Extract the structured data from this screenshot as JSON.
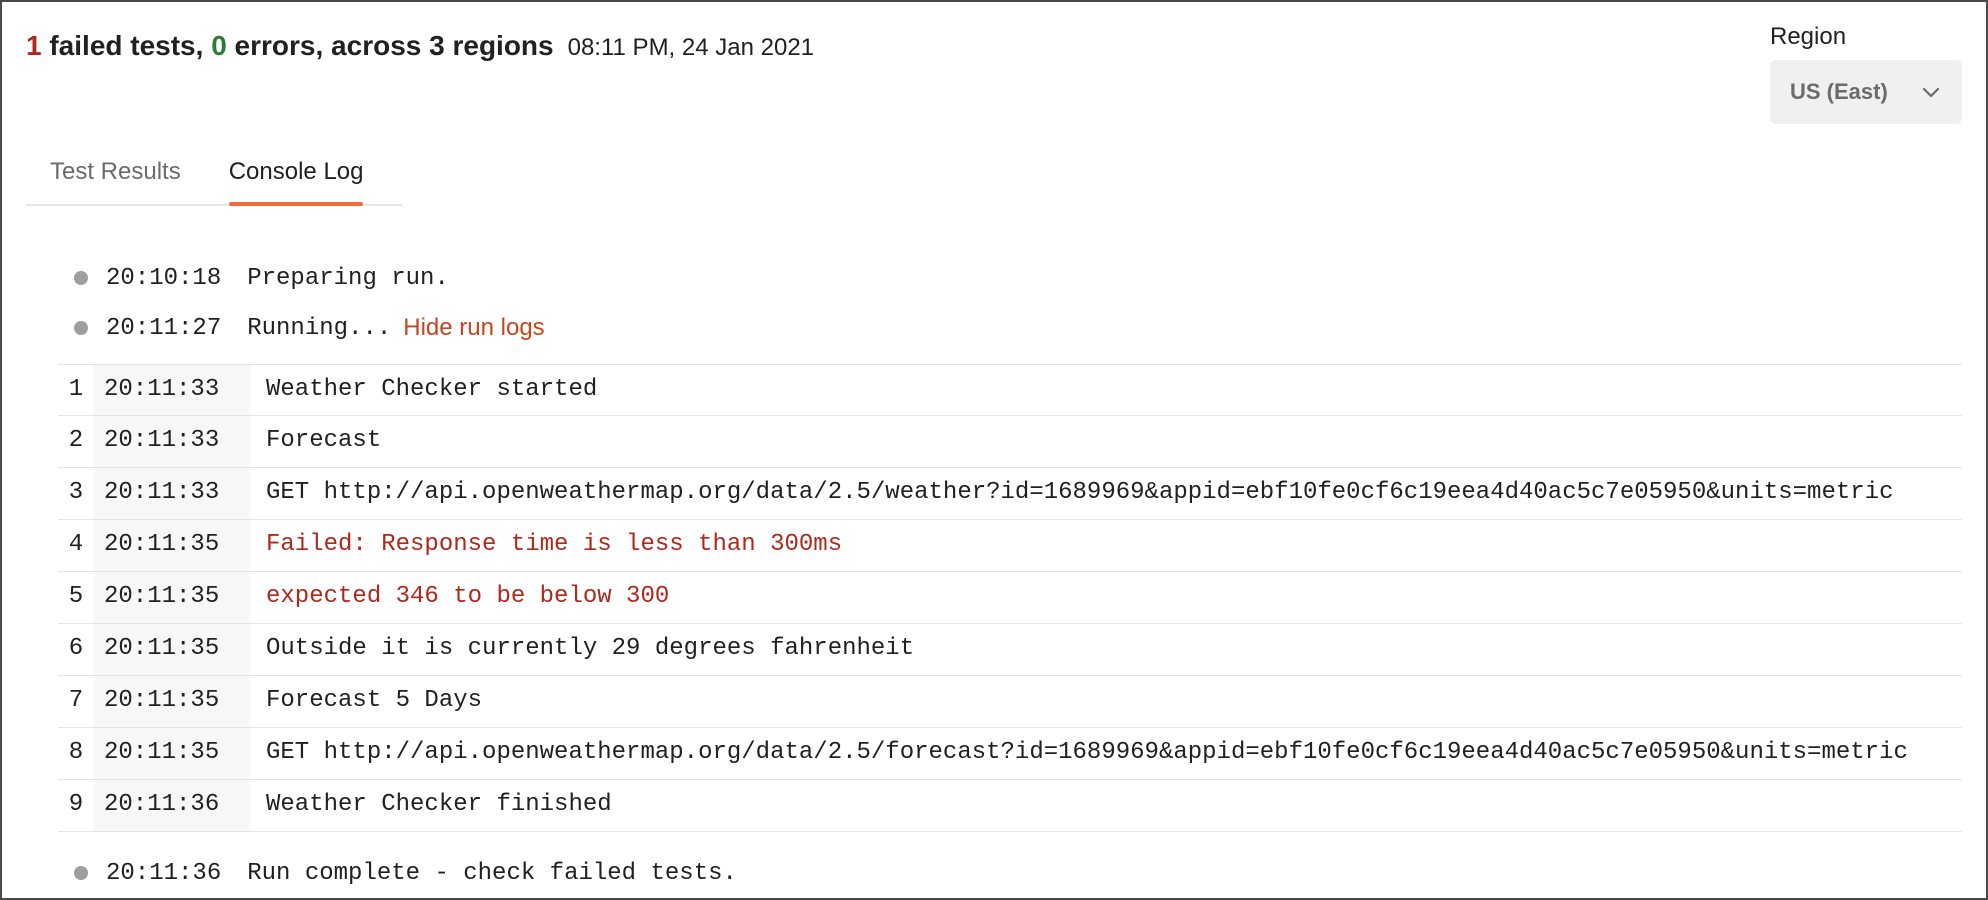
{
  "header": {
    "failed_count": "1",
    "failed_text": " failed tests, ",
    "error_count": "0",
    "error_text": " errors, across 3 regions",
    "timestamp": "08:11 PM, 24 Jan 2021"
  },
  "region": {
    "label": "Region",
    "selected": "US (East)"
  },
  "tabs": [
    {
      "label": "Test Results",
      "active": false
    },
    {
      "label": "Console Log",
      "active": true
    }
  ],
  "console": {
    "pre_status": [
      {
        "time": "20:10:18",
        "text": "Preparing run."
      },
      {
        "time": "20:11:27",
        "text": "Running...",
        "link": "Hide run logs"
      }
    ],
    "logs": [
      {
        "index": "1",
        "time": "20:11:33",
        "message": "Weather Checker started",
        "error": false
      },
      {
        "index": "2",
        "time": "20:11:33",
        "message": "Forecast",
        "error": false
      },
      {
        "index": "3",
        "time": "20:11:33",
        "message": "GET http://api.openweathermap.org/data/2.5/weather?id=1689969&appid=ebf10fe0cf6c19eea4d40ac5c7e05950&units=metric",
        "error": false
      },
      {
        "index": "4",
        "time": "20:11:35",
        "message": "Failed: Response time is less than 300ms",
        "error": true
      },
      {
        "index": "5",
        "time": "20:11:35",
        "message": "expected 346 to be below 300",
        "error": true
      },
      {
        "index": "6",
        "time": "20:11:35",
        "message": "Outside it is currently 29 degrees fahrenheit",
        "error": false
      },
      {
        "index": "7",
        "time": "20:11:35",
        "message": "Forecast 5 Days",
        "error": false
      },
      {
        "index": "8",
        "time": "20:11:35",
        "message": "GET http://api.openweathermap.org/data/2.5/forecast?id=1689969&appid=ebf10fe0cf6c19eea4d40ac5c7e05950&units=metric",
        "error": false
      },
      {
        "index": "9",
        "time": "20:11:36",
        "message": "Weather Checker finished",
        "error": false
      }
    ],
    "post_status": {
      "time": "20:11:36",
      "text": "Run complete - check failed tests."
    }
  },
  "colors": {
    "failed": "#b3261e",
    "errors_ok": "#2e7d32",
    "tab_accent": "#f26b3a",
    "link": "#c6451f",
    "error_text": "#b0281c"
  }
}
